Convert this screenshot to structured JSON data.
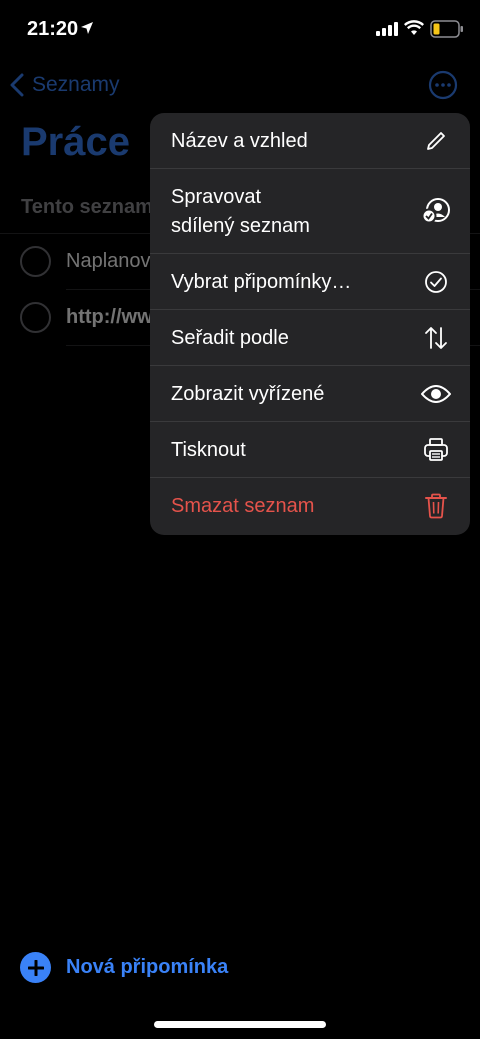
{
  "status_bar": {
    "time": "21:20"
  },
  "nav": {
    "back_label": "Seznamy"
  },
  "list": {
    "title": "Práce",
    "section_header": "Tento seznam",
    "items": [
      {
        "text": "Naplanov",
        "bold": false
      },
      {
        "text": "http://ww",
        "bold": true
      }
    ]
  },
  "new_reminder": {
    "label": "Nová připomínka"
  },
  "menu": {
    "items": [
      {
        "label": "Název a vzhled",
        "icon": "pencil-icon"
      },
      {
        "label_line1": "Spravovat",
        "label_line2": "sdílený seznam",
        "icon": "shared-people-icon"
      },
      {
        "label": "Vybrat připomínky…",
        "icon": "checkmark-circle-icon"
      },
      {
        "label": "Seřadit podle",
        "icon": "sort-arrows-icon"
      },
      {
        "label": "Zobrazit vyřízené",
        "icon": "eye-icon"
      },
      {
        "label": "Tisknout",
        "icon": "printer-icon"
      },
      {
        "label": "Smazat seznam",
        "icon": "trash-icon",
        "destructive": true
      }
    ]
  },
  "colors": {
    "accent": "#3a82f7",
    "destructive": "#e5534b",
    "menu_bg": "#252527",
    "battery": "#f5c518"
  }
}
